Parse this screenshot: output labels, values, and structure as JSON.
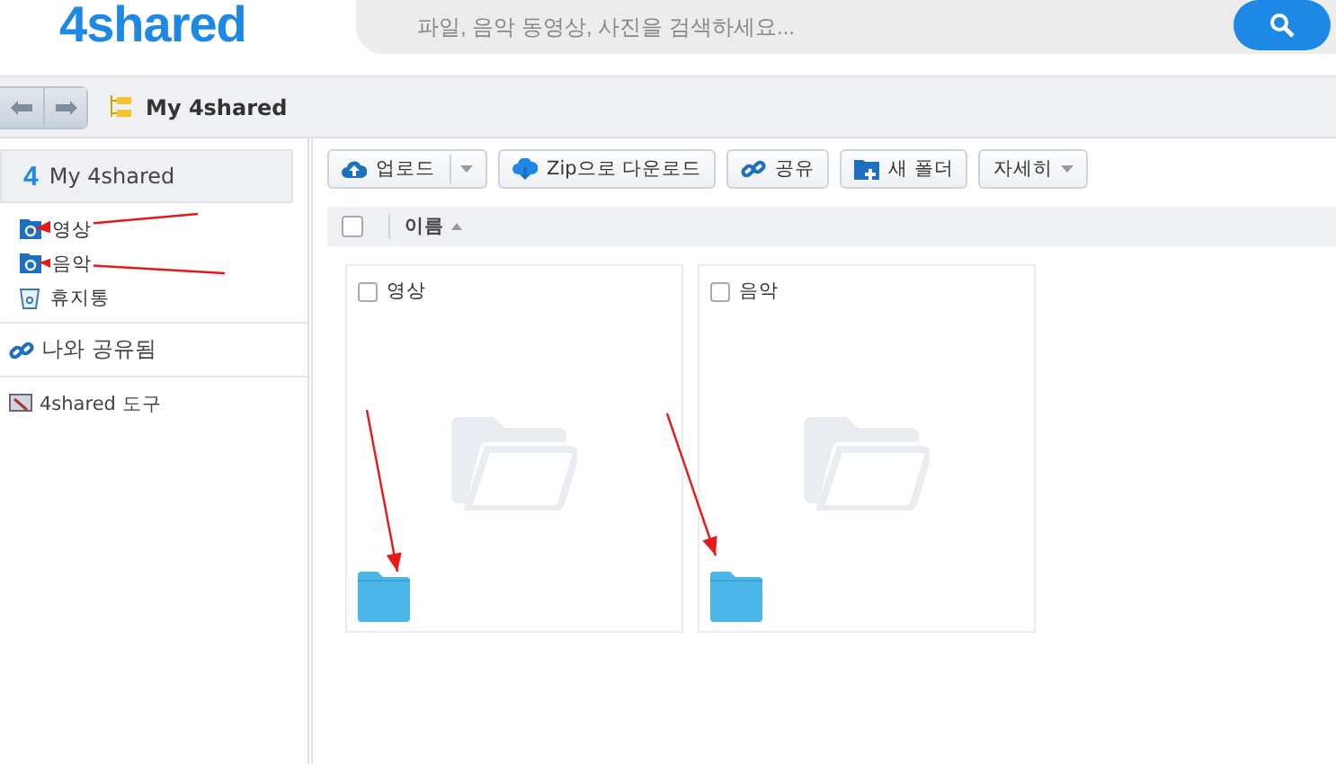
{
  "logo": "4shared",
  "search": {
    "placeholder": "파일, 음악 동영상, 사진을 검색하세요..."
  },
  "breadcrumb": "My 4shared",
  "sidebar": {
    "header": {
      "icon_text": "4",
      "label": "My 4shared",
      "selected": true
    },
    "folders": [
      {
        "label": "영상",
        "kind": "folder"
      },
      {
        "label": "음악",
        "kind": "folder"
      },
      {
        "label": "휴지통",
        "kind": "trash"
      }
    ],
    "sections": [
      {
        "label": "나와 공유됨",
        "kind": "shared"
      },
      {
        "label": "4shared 도구",
        "kind": "tools"
      }
    ]
  },
  "toolbar": [
    {
      "label": "업로드",
      "kind": "upload",
      "dropdown": true
    },
    {
      "label": "Zip으로 다운로드",
      "kind": "zip",
      "dropdown": false
    },
    {
      "label": "공유",
      "kind": "share",
      "dropdown": false
    },
    {
      "label": "새 폴더",
      "kind": "new-folder",
      "dropdown": false
    },
    {
      "label": "자세히",
      "kind": "more",
      "dropdown": true
    }
  ],
  "list_header": {
    "label": "이름",
    "sort_ascending": true,
    "checked": false
  },
  "items": [
    {
      "name": "영상",
      "checked": false
    },
    {
      "name": "음악",
      "checked": false
    }
  ]
}
